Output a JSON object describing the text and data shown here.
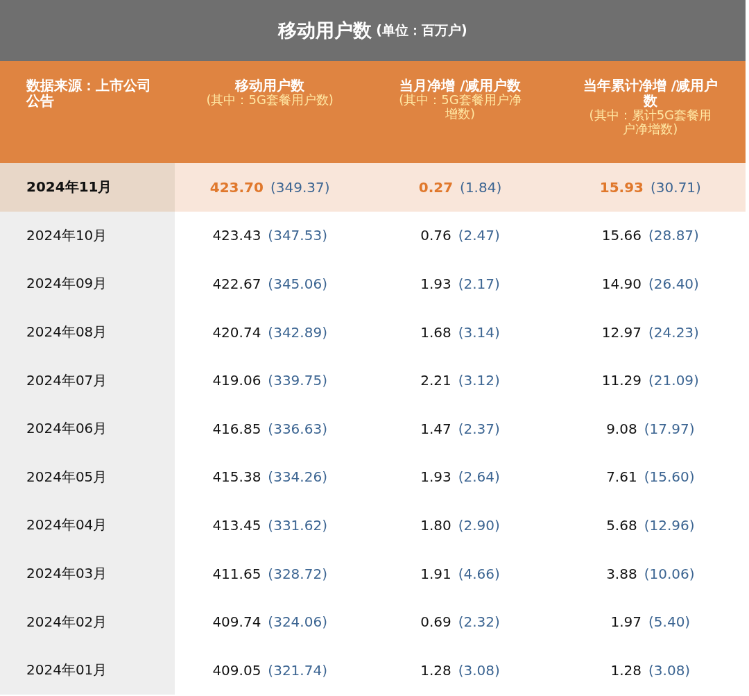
{
  "title": {
    "main": "移动用户数",
    "unit": "(单位：百万户)"
  },
  "columns": [
    {
      "label": "数据来源：上市公司公告"
    },
    {
      "label": "移动用户数",
      "note": "(其中：5G套餐用户数)"
    },
    {
      "label": "当月净增 /减用户数",
      "note": "(其中：5G套餐用户净增数)"
    },
    {
      "label": "当年累计净增 /减用户数",
      "note": "(其中：累计5G套餐用户净增数)"
    }
  ],
  "rows": [
    {
      "month": "2024年11月",
      "highlighted": true,
      "values": [
        [
          "423.70",
          "(349.37)"
        ],
        [
          "0.27",
          "(1.84)"
        ],
        [
          "15.93",
          "(30.71)"
        ]
      ]
    },
    {
      "month": "2024年10月",
      "highlighted": false,
      "values": [
        [
          "423.43",
          "(347.53)"
        ],
        [
          "0.76",
          "(2.47)"
        ],
        [
          "15.66",
          "(28.87)"
        ]
      ]
    },
    {
      "month": "2024年09月",
      "highlighted": false,
      "values": [
        [
          "422.67",
          "(345.06)"
        ],
        [
          "1.93",
          "(2.17)"
        ],
        [
          "14.90",
          "(26.40)"
        ]
      ]
    },
    {
      "month": "2024年08月",
      "highlighted": false,
      "values": [
        [
          "420.74",
          "(342.89)"
        ],
        [
          "1.68",
          "(3.14)"
        ],
        [
          "12.97",
          "(24.23)"
        ]
      ]
    },
    {
      "month": "2024年07月",
      "highlighted": false,
      "values": [
        [
          "419.06",
          "(339.75)"
        ],
        [
          "2.21",
          "(3.12)"
        ],
        [
          "11.29",
          "(21.09)"
        ]
      ]
    },
    {
      "month": "2024年06月",
      "highlighted": false,
      "values": [
        [
          "416.85",
          "(336.63)"
        ],
        [
          "1.47",
          "(2.37)"
        ],
        [
          "9.08",
          "(17.97)"
        ]
      ]
    },
    {
      "month": "2024年05月",
      "highlighted": false,
      "values": [
        [
          "415.38",
          "(334.26)"
        ],
        [
          "1.93",
          "(2.64)"
        ],
        [
          "7.61",
          "(15.60)"
        ]
      ]
    },
    {
      "month": "2024年04月",
      "highlighted": false,
      "values": [
        [
          "413.45",
          "(331.62)"
        ],
        [
          "1.80",
          "(2.90)"
        ],
        [
          "5.68",
          "(12.96)"
        ]
      ]
    },
    {
      "month": "2024年03月",
      "highlighted": false,
      "values": [
        [
          "411.65",
          "(328.72)"
        ],
        [
          "1.91",
          "(4.66)"
        ],
        [
          "3.88",
          "(10.06)"
        ]
      ]
    },
    {
      "month": "2024年02月",
      "highlighted": false,
      "values": [
        [
          "409.74",
          "(324.06)"
        ],
        [
          "0.69",
          "(2.32)"
        ],
        [
          "1.97",
          "(5.40)"
        ]
      ]
    },
    {
      "month": "2024年01月",
      "highlighted": false,
      "values": [
        [
          "409.05",
          "(321.74)"
        ],
        [
          "1.28",
          "(3.08)"
        ],
        [
          "1.28",
          "(3.08)"
        ]
      ]
    }
  ]
}
